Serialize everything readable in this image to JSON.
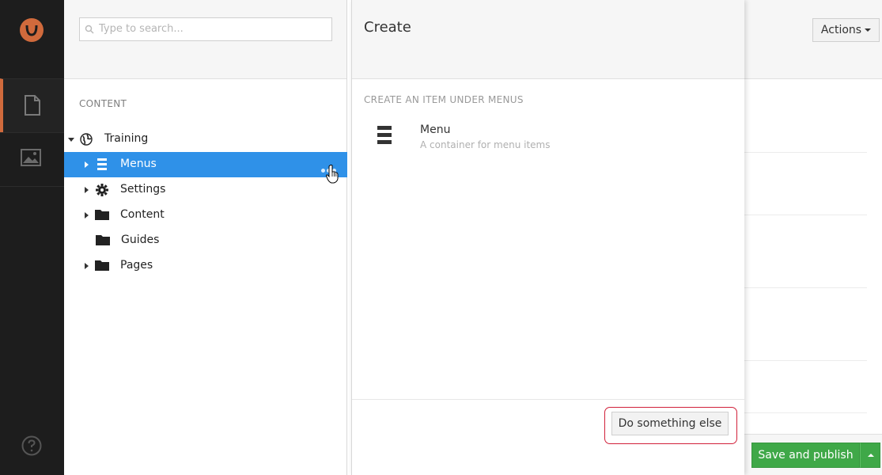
{
  "tree": {
    "search_placeholder": "Type to search...",
    "section_label": "CONTENT",
    "nodes": [
      {
        "label": "Training",
        "icon": "globe-icon"
      },
      {
        "label": "Menus",
        "icon": "menu-list-icon"
      },
      {
        "label": "Settings",
        "icon": "gear-icon"
      },
      {
        "label": "Content",
        "icon": "folder-icon"
      },
      {
        "label": "Guides",
        "icon": "folder-icon"
      },
      {
        "label": "Pages",
        "icon": "folder-icon"
      }
    ]
  },
  "create": {
    "title": "Create",
    "subtitle": "CREATE AN ITEM UNDER MENUS",
    "item_name": "Menu",
    "item_desc": "A container for menu items",
    "secondary_button": "Do something else"
  },
  "editor": {
    "actions_label": "Actions",
    "save_label": "Save and publish"
  },
  "colors": {
    "selected": "#2f91e8",
    "save": "#3fa848",
    "highlight": "#d1213a",
    "appbar": "#1d1d1d"
  }
}
